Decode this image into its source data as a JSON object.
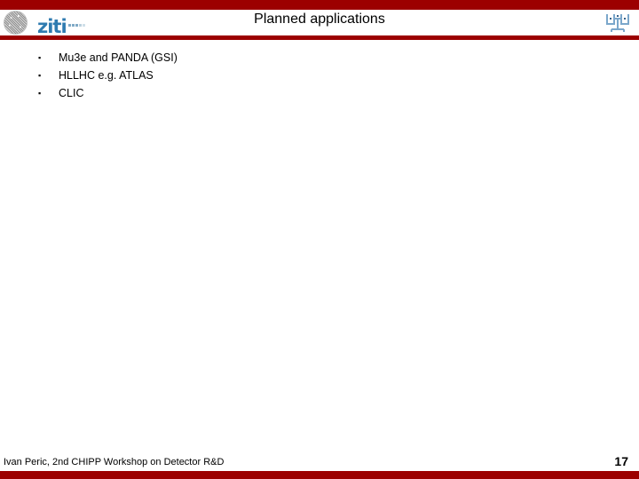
{
  "slide": {
    "title": "Planned applications",
    "page_number": "17",
    "accent_color": "#9c0000",
    "logo_blue": "#2f7bb0",
    "kip_logo_blue": "#7ba7cb"
  },
  "header": {
    "left_logo_name": "ziti-logo",
    "left_logo_wordmark": "ziti",
    "left_logo_seal_name": "university-seal-icon",
    "right_logo_name": "kip-institute-logo"
  },
  "body": {
    "bullet_marker": "▪",
    "bullets": [
      {
        "text": "Mu3e and PANDA (GSI)"
      },
      {
        "text": "HLLHC e.g. ATLAS"
      },
      {
        "text": "CLIC"
      }
    ]
  },
  "footer": {
    "text": "Ivan Peric, 2nd CHIPP Workshop on Detector R&D"
  }
}
